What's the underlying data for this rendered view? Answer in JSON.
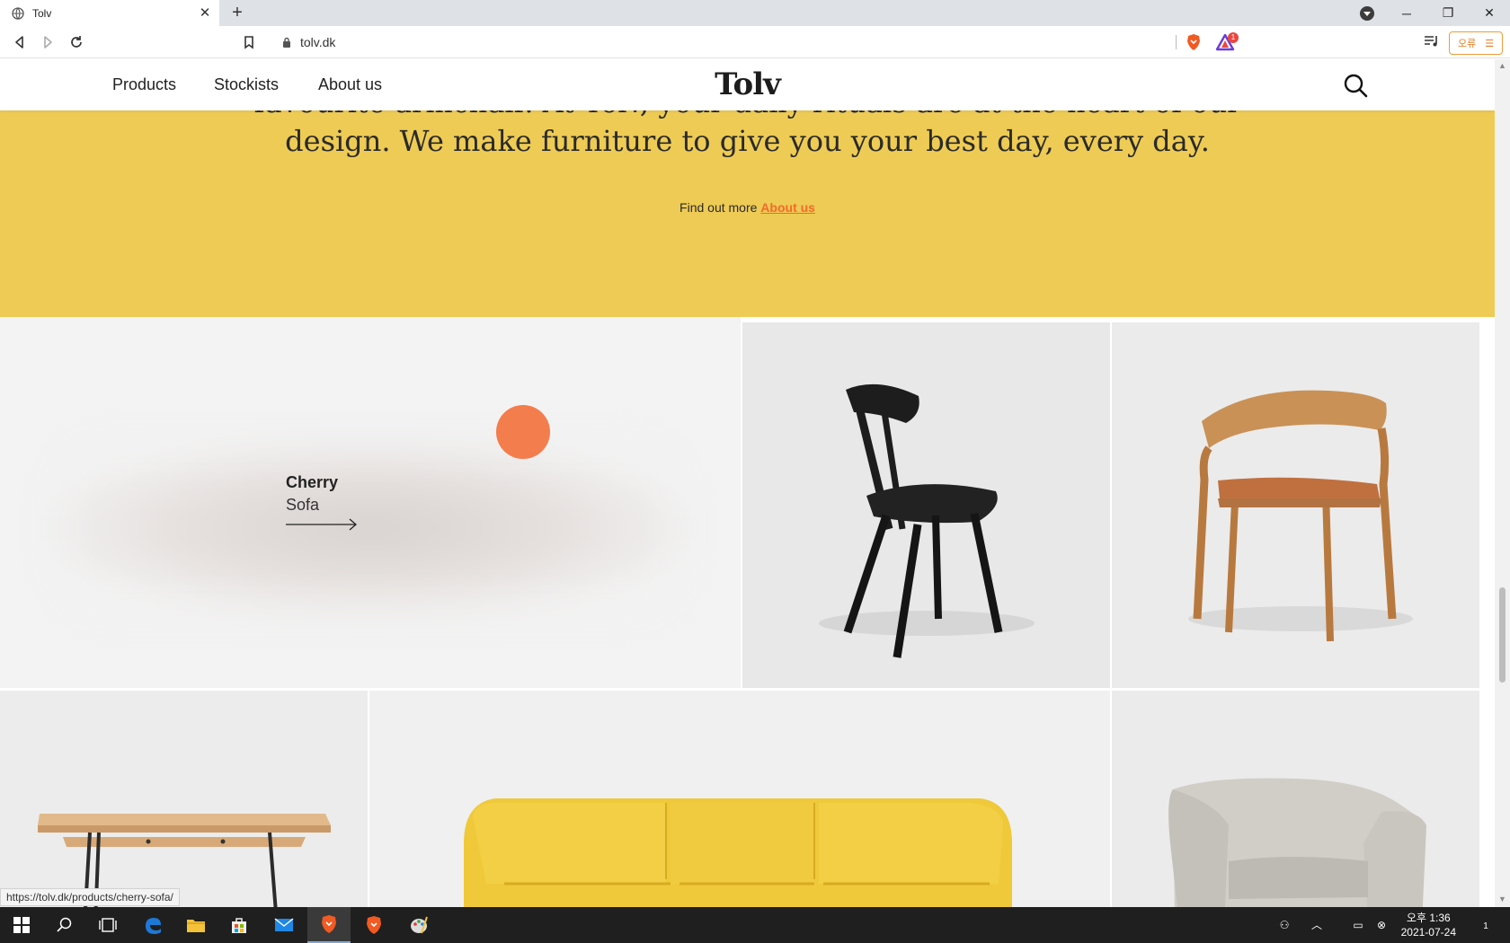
{
  "browser": {
    "tab_title": "Tolv",
    "url": "tolv.dk",
    "error_button_label": "오류",
    "rewards_badge": "1",
    "status_url": "https://tolv.dk/products/cherry-sofa/"
  },
  "site": {
    "logo": "Tolv",
    "nav": [
      "Products",
      "Stockists",
      "About us"
    ]
  },
  "hero": {
    "line1": "favourite armchair. At Tolv, your daily rituals are at the heart of our",
    "line2": "design. We make furniture to give you your best day, every day.",
    "find_more": "Find out more",
    "about_link": "About us",
    "bg_color": "#eecb54",
    "accent_color": "#f26b2a"
  },
  "featured": {
    "name": "Cherry",
    "type": "Sofa",
    "dot_color": "#f47d4d"
  },
  "taskbar": {
    "time": "오후 1:36",
    "date": "2021-07-24",
    "notification_count": "1"
  }
}
